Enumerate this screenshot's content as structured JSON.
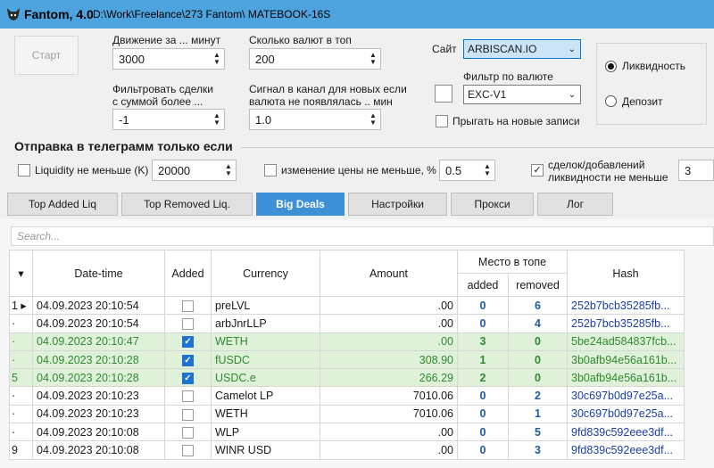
{
  "window": {
    "title": "Fantom, 4.0",
    "path": "D:\\Work\\Freelance\\273 Fantom\\   MATEBOOK-16S"
  },
  "controls": {
    "start_label": "Старт",
    "movement_label": "Движение за ... минут",
    "movement_value": "3000",
    "top_count_label": "Сколько валют в топ",
    "top_count_value": "200",
    "filter_label_1": "Фильтровать сделки",
    "filter_label_2": "с суммой более ...",
    "filter_value": "-1",
    "signal_label_1": "Сигнал в канал для новых если",
    "signal_label_2": "валюта не появлялась .. мин",
    "signal_value": "1.0",
    "site_label": "Сайт",
    "site_value": "ARBISCAN.IO",
    "currency_filter_label": "Фильтр по валюте",
    "currency_filter_value": "EXC-V1",
    "jump_label": "Прыгать на новые записи",
    "radio_liquidity": "Ликвидность",
    "radio_deposit": "Депозит"
  },
  "telegram": {
    "section_title": "Отправка в телеграмм только если",
    "liquidity_label": "Liquidity не меньше (K)",
    "liquidity_value": "20000",
    "price_change_label": "изменение цены не меньше, %",
    "price_change_value": "0.5",
    "deals_label_1": "сделок/добавлений",
    "deals_label_2": "ликвидности не меньше",
    "deals_value": "3"
  },
  "tabs": [
    "Top Added Liq",
    "Top Removed Liq.",
    "Big Deals",
    "Настройки",
    "Прокси",
    "Лог"
  ],
  "active_tab": "Big Deals",
  "search_placeholder": "Search...",
  "grid": {
    "headers": {
      "datetime": "Date-time",
      "added": "Added",
      "currency": "Currency",
      "amount": "Amount",
      "place_group": "Место в топе",
      "place_added": "added",
      "place_removed": "removed",
      "hash": "Hash"
    },
    "rows": [
      {
        "indicator": "1 ▸",
        "datetime": "04.09.2023 20:10:54",
        "added": false,
        "currency": "preLVL",
        "amount": ".00",
        "rank_added": "0",
        "rank_removed": "6",
        "hash": "252b7bcb35285fb...",
        "highlight": false
      },
      {
        "indicator": "·",
        "datetime": "04.09.2023 20:10:54",
        "added": false,
        "currency": "arbJnrLLP",
        "amount": ".00",
        "rank_added": "0",
        "rank_removed": "4",
        "hash": "252b7bcb35285fb...",
        "highlight": false
      },
      {
        "indicator": "·",
        "datetime": "04.09.2023 20:10:47",
        "added": true,
        "currency": "WETH",
        "amount": ".00",
        "rank_added": "3",
        "rank_removed": "0",
        "hash": "5be24ad584837fcb...",
        "highlight": true
      },
      {
        "indicator": "·",
        "datetime": "04.09.2023 20:10:28",
        "added": true,
        "currency": "fUSDC",
        "amount": "308.90",
        "rank_added": "1",
        "rank_removed": "0",
        "hash": "3b0afb94e56a161b...",
        "highlight": true
      },
      {
        "indicator": "5",
        "datetime": "04.09.2023 20:10:28",
        "added": true,
        "currency": "USDC.e",
        "amount": "266.29",
        "rank_added": "2",
        "rank_removed": "0",
        "hash": "3b0afb94e56a161b...",
        "highlight": true
      },
      {
        "indicator": "·",
        "datetime": "04.09.2023 20:10:23",
        "added": false,
        "currency": "Camelot LP",
        "amount": "7010.06",
        "rank_added": "0",
        "rank_removed": "2",
        "hash": "30c697b0d97e25a...",
        "highlight": false
      },
      {
        "indicator": "·",
        "datetime": "04.09.2023 20:10:23",
        "added": false,
        "currency": "WETH",
        "amount": "7010.06",
        "rank_added": "0",
        "rank_removed": "1",
        "hash": "30c697b0d97e25a...",
        "highlight": false
      },
      {
        "indicator": "·",
        "datetime": "04.09.2023 20:10:08",
        "added": false,
        "currency": "WLP",
        "amount": ".00",
        "rank_added": "0",
        "rank_removed": "5",
        "hash": "9fd839c592eee3df...",
        "highlight": false
      },
      {
        "indicator": "9",
        "datetime": "04.09.2023 20:10:08",
        "added": false,
        "currency": "WINR USD",
        "amount": ".00",
        "rank_added": "0",
        "rank_removed": "3",
        "hash": "9fd839c592eee3df...",
        "highlight": false
      }
    ]
  },
  "colors": {
    "titlebar": "#4da3dd",
    "active_tab": "#3d8fd6",
    "highlight_row": "#dff1d9",
    "highlight_text": "#2e8b2e",
    "rank_text": "#1e5aa8",
    "hash_text": "#1a3ea8"
  }
}
